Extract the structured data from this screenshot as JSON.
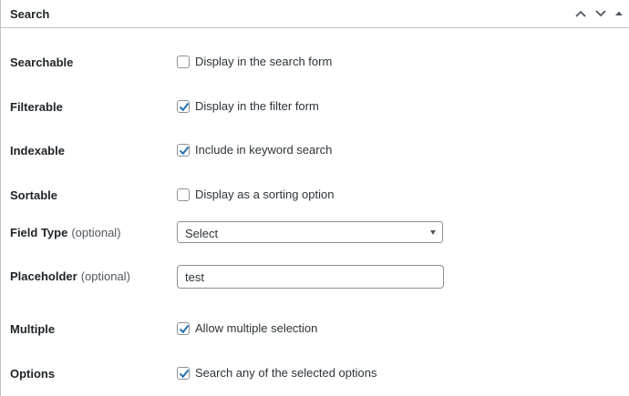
{
  "panel": {
    "title": "Search",
    "collapse_up_icon": "chevron-up-icon",
    "collapse_down_icon": "chevron-down-icon",
    "toggle_icon": "triangle-up-icon"
  },
  "fields": {
    "searchable": {
      "label": "Searchable",
      "checkbox_label": "Display in the search form",
      "checked": false
    },
    "filterable": {
      "label": "Filterable",
      "checkbox_label": "Display in the filter form",
      "checked": true
    },
    "indexable": {
      "label": "Indexable",
      "checkbox_label": "Include in keyword search",
      "checked": true
    },
    "sortable": {
      "label": "Sortable",
      "checkbox_label": "Display as a sorting option",
      "checked": false
    },
    "field_type": {
      "label": "Field Type",
      "optional": "(optional)",
      "value": "Select"
    },
    "placeholder": {
      "label": "Placeholder",
      "optional": "(optional)",
      "value": "test"
    },
    "multiple": {
      "label": "Multiple",
      "checkbox_label": "Allow multiple selection",
      "checked": true
    },
    "options": {
      "label": "Options",
      "checkbox_label": "Search any of the selected options",
      "checked": true
    }
  },
  "colors": {
    "checkmark": "#2271b1",
    "border": "#8c8f94",
    "text": "#1d2327"
  }
}
